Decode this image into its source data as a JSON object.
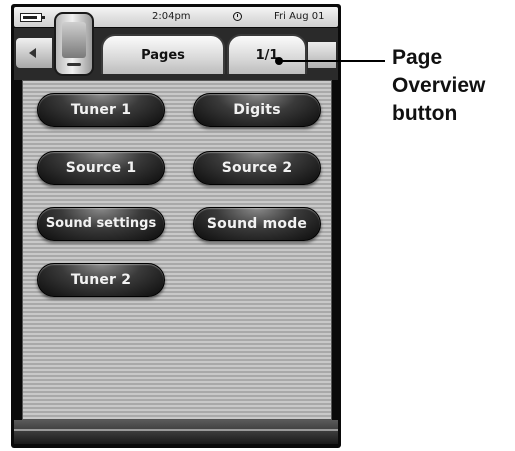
{
  "status_bar": {
    "battery_icon": "battery-icon",
    "time": "2:04pm",
    "clock_icon": "clock-icon",
    "date": "Fri Aug 01"
  },
  "tabs": {
    "back_icon": "chevron-left-icon",
    "device_icon": "remote-control-icon",
    "pages_label": "Pages",
    "page_overview_label": "1/1"
  },
  "buttons": [
    {
      "label": "Tuner 1"
    },
    {
      "label": "Digits"
    },
    {
      "label": "Source 1"
    },
    {
      "label": "Source 2"
    },
    {
      "label": "Sound settings"
    },
    {
      "label": "Sound mode"
    },
    {
      "label": "Tuner 2"
    }
  ],
  "callout": {
    "line1": "Page",
    "line2": "Overview",
    "line3": "button"
  }
}
